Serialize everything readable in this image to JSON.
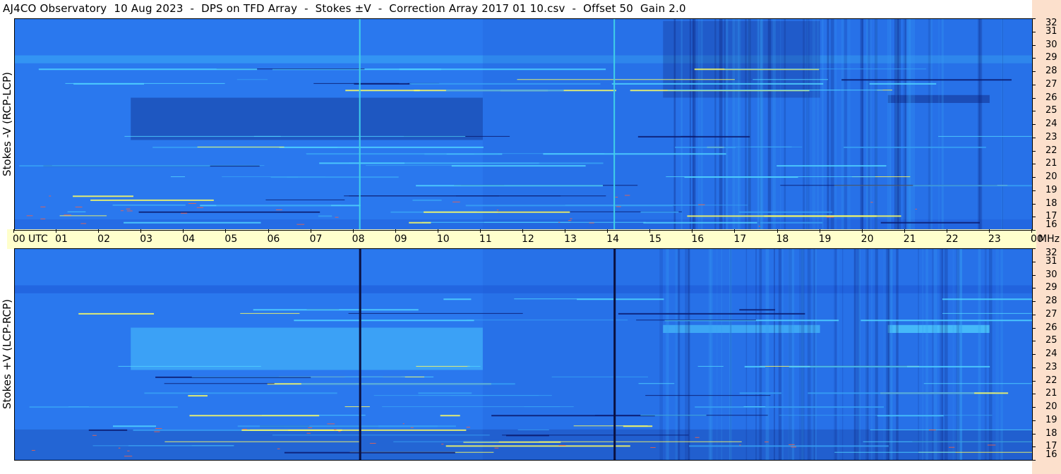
{
  "header": {
    "title": "AJ4CO Observatory  10 Aug 2023  -  DPS on TFD Array  -  Stokes ±V  -  Correction Array 2017 01 10.csv  -  Offset 50  Gain 2.0"
  },
  "chart_data": [
    {
      "type": "heatmap",
      "title": "",
      "ylabel": "Stokes -V (RCP-LCP)",
      "xlabel": "UTC",
      "x_unit": "UTC",
      "y_unit": "MHz",
      "xlim": [
        0,
        24
      ],
      "ylim": [
        16,
        32
      ],
      "x_ticks": [
        "00",
        "01",
        "02",
        "03",
        "04",
        "05",
        "06",
        "07",
        "08",
        "09",
        "10",
        "11",
        "12",
        "13",
        "14",
        "15",
        "16",
        "17",
        "18",
        "19",
        "20",
        "21",
        "22",
        "23",
        "00"
      ],
      "y_ticks": [
        "16",
        "17",
        "18",
        "19",
        "20",
        "21",
        "22",
        "23",
        "24",
        "25",
        "26",
        "27",
        "28",
        "29",
        "30",
        "31",
        "32"
      ],
      "colormap": [
        "#0a1a6e",
        "#1e5ad8",
        "#2a78ee",
        "#37a0f5",
        "#50d2ff",
        "#ffff60",
        "#ff6040"
      ],
      "vertical_lines_utc": [
        8.15,
        14.15
      ],
      "vertical_line_color": "#40d0e8"
    },
    {
      "type": "heatmap",
      "title": "",
      "ylabel": "Stokes +V (LCP-RCP)",
      "xlabel": "UTC",
      "x_unit": "UTC",
      "y_unit": "MHz",
      "xlim": [
        0,
        24
      ],
      "ylim": [
        16,
        32
      ],
      "x_ticks": [
        "00",
        "01",
        "02",
        "03",
        "04",
        "05",
        "06",
        "07",
        "08",
        "09",
        "10",
        "11",
        "12",
        "13",
        "14",
        "15",
        "16",
        "17",
        "18",
        "19",
        "20",
        "21",
        "22",
        "23",
        "00"
      ],
      "y_ticks": [
        "16",
        "17",
        "18",
        "19",
        "20",
        "21",
        "22",
        "23",
        "24",
        "25",
        "26",
        "27",
        "28",
        "29",
        "30",
        "31",
        "32"
      ],
      "colormap": [
        "#0a1a6e",
        "#1e5ad8",
        "#2a78ee",
        "#37a0f5",
        "#50d2ff",
        "#ffff60",
        "#ff6040"
      ],
      "vertical_lines_utc": [
        8.15,
        14.15
      ],
      "vertical_line_color": "#0a1040"
    }
  ],
  "axis": {
    "utc_label": "UTC",
    "mhz_label": "MHz"
  }
}
